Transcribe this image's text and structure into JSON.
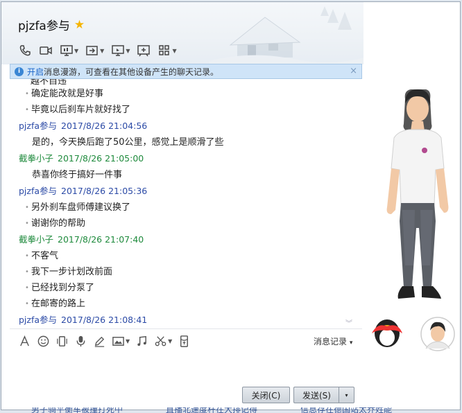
{
  "window": {
    "title": "pjzfa参与",
    "controls": [
      "▾",
      "—",
      "☐",
      "✕"
    ]
  },
  "toolbar": {
    "icons": [
      "phone-icon",
      "video-icon",
      "screen-share-icon",
      "file-transfer-icon",
      "remote-desktop-icon",
      "whiteboard-icon",
      "apps-grid-icon"
    ]
  },
  "notice": {
    "link": "开启",
    "text": "消息漫游，可查看在其他设备产生的聊天记录。",
    "close": "×"
  },
  "chat": {
    "cut_text": "越不自违",
    "messages": [
      {
        "type": "line",
        "text": "确定能改就是好事"
      },
      {
        "type": "line",
        "text": "毕竟以后刹车片就好找了"
      },
      {
        "type": "sender",
        "color": "blue",
        "name": "pjzfa参与",
        "time": "2017/8/26 21:04:56"
      },
      {
        "type": "plain",
        "text": "是的，今天换后跑了50公里，感觉上是顺滑了些"
      },
      {
        "type": "sender",
        "color": "green",
        "name": "截拳小子",
        "time": "2017/8/26 21:05:00"
      },
      {
        "type": "plain",
        "text": "恭喜你终于搞好一件事"
      },
      {
        "type": "sender",
        "color": "blue",
        "name": "pjzfa参与",
        "time": "2017/8/26 21:05:36"
      },
      {
        "type": "line",
        "text": "另外刹车盘师傅建议换了"
      },
      {
        "type": "line",
        "text": "谢谢你的帮助"
      },
      {
        "type": "sender",
        "color": "green",
        "name": "截拳小子",
        "time": "2017/8/26 21:07:40"
      },
      {
        "type": "line",
        "text": "不客气"
      },
      {
        "type": "line",
        "text": "我下一步计划改前面"
      },
      {
        "type": "line",
        "text": "已经找到分泵了"
      },
      {
        "type": "line",
        "text": "在邮寄的路上"
      },
      {
        "type": "sender",
        "color": "blue",
        "name": "pjzfa参与",
        "time": "2017/8/26 21:08:41"
      }
    ]
  },
  "input_toolbar": {
    "icons": [
      "font-icon",
      "emoji-icon",
      "vibrate-icon",
      "voice-icon",
      "doodle-icon",
      "image-icon",
      "music-icon",
      "screenshot-icon",
      "red-packet-icon"
    ],
    "history_label": "消息记录",
    "history_caret": "▾"
  },
  "buttons": {
    "close_label": "关闭(C)",
    "send_label": "发送(S)",
    "send_dropdown": "▾"
  },
  "bottom_strip": [
    "男子骑平衡车被撞打死中",
    "直播北速度杆在大排记得",
    "信息存在德国站太乔姓能"
  ]
}
